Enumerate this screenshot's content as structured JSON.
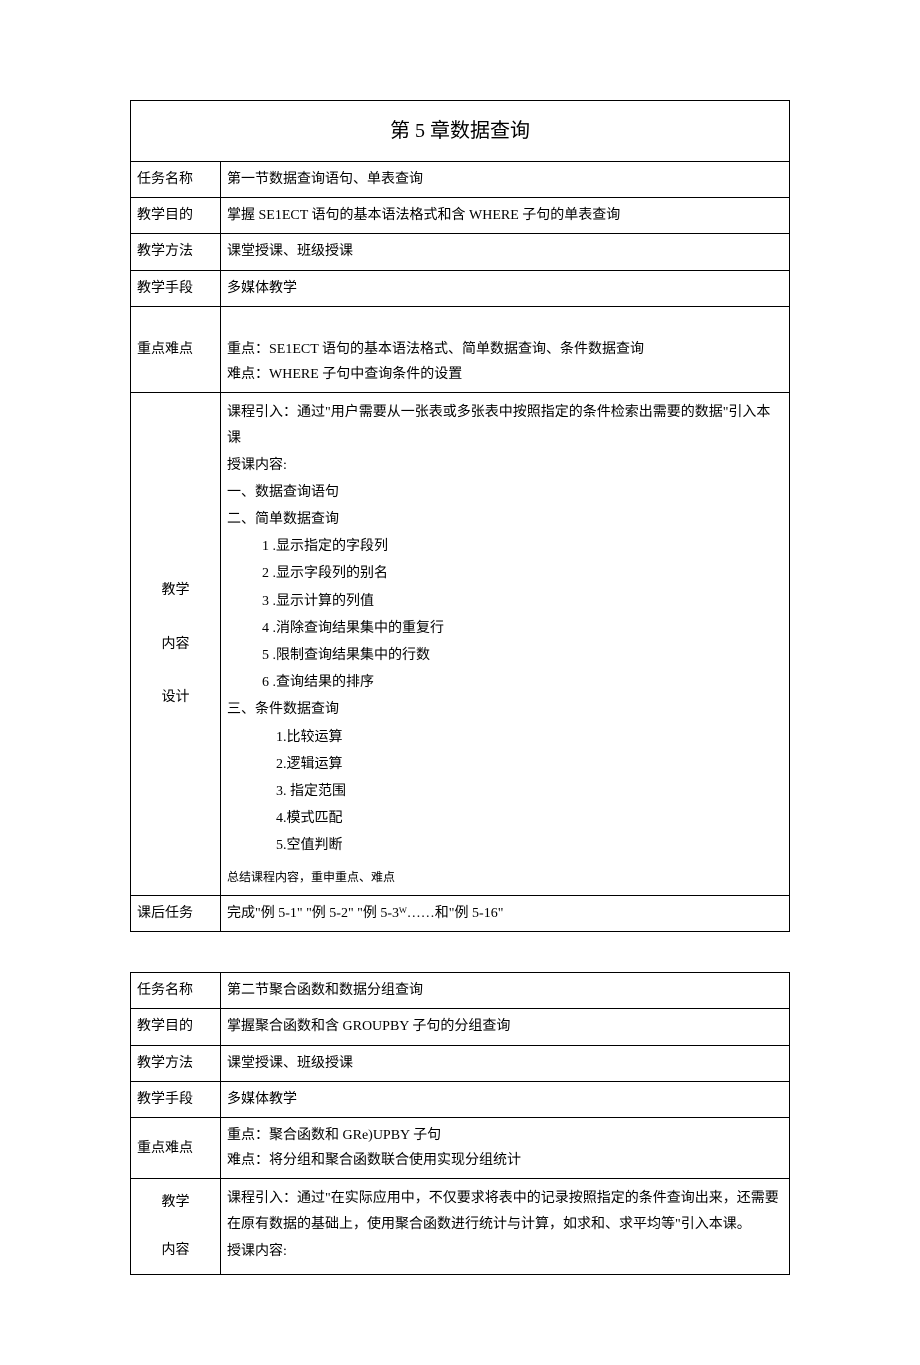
{
  "table1": {
    "title": "第 5 章数据查询",
    "rows": {
      "taskName": {
        "label": "任务名称",
        "value": "第一节数据查询语句、单表查询"
      },
      "objective": {
        "label": "教学目的",
        "value": "掌握 SE1ECT 语句的基本语法格式和含 WHERE 子句的单表查询"
      },
      "method": {
        "label": "教学方法",
        "value": "课堂授课、班级授课"
      },
      "means": {
        "label": "教学手段",
        "value": "多媒体教学"
      },
      "keypoints": {
        "label": "重点难点",
        "line1": "重点：SE1ECT 语句的基本语法格式、简单数据查询、条件数据查询",
        "line2": "难点：WHERE 子句中查询条件的设置"
      },
      "content": {
        "label1": "教学",
        "label2": "内容",
        "label3": "设计",
        "intro": "课程引入：通过\"用户需要从一张表或多张表中按照指定的条件检索出需要的数据\"引入本课",
        "sectionHeader": "授课内容:",
        "s1": "一、数据查询语句",
        "s2": "二、简单数据查询",
        "s2_1": "1 .显示指定的字段列",
        "s2_2": "2 .显示字段列的别名",
        "s2_3": "3 .显示计算的列值",
        "s2_4": "4 .消除查询结果集中的重复行",
        "s2_5": "5 .限制查询结果集中的行数",
        "s2_6": "6 .查询结果的排序",
        "s3": "三、条件数据查询",
        "s3_1": "1.比较运算",
        "s3_2": "2.逻辑运算",
        "s3_3": "3. 指定范围",
        "s3_4": "4.模式匹配",
        "s3_5": "5.空值判断",
        "summary": "总结课程内容，重申重点、难点"
      },
      "homework": {
        "label": "课后任务",
        "value": "完成\"例 5-1\" \"例 5-2\" \"例 5-3ᵂ……和\"例 5-16\""
      }
    }
  },
  "table2": {
    "rows": {
      "taskName": {
        "label": "任务名称",
        "value": "第二节聚合函数和数据分组查询"
      },
      "objective": {
        "label": "教学目的",
        "value": "掌握聚合函数和含 GROUPBY 子句的分组查询"
      },
      "method": {
        "label": "教学方法",
        "value": "课堂授课、班级授课"
      },
      "means": {
        "label": "教学手段",
        "value": "多媒体教学"
      },
      "keypoints": {
        "label": "重点难点",
        "line1": "重点：聚合函数和 GRe)UPBY 子句",
        "line2": "难点：将分组和聚合函数联合使用实现分组统计"
      },
      "content": {
        "label1": "教学",
        "label2": "内容",
        "intro": "课程引入：通过\"在实际应用中，不仅要求将表中的记录按照指定的条件查询出来，还需要在原有数据的基础上，使用聚合函数进行统计与计算，如求和、求平均等\"引入本课。",
        "sectionHeader": "授课内容:"
      }
    }
  }
}
